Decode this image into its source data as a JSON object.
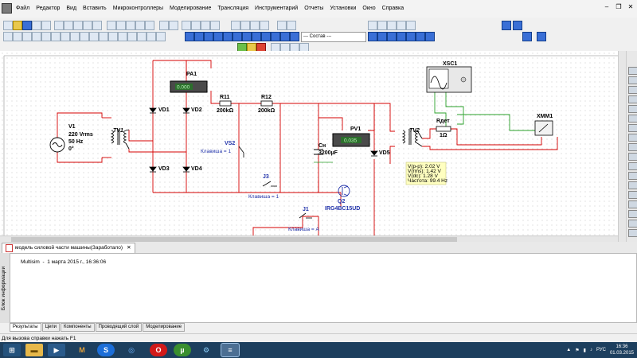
{
  "menu": {
    "items": [
      "Файл",
      "Редактор",
      "Вид",
      "Вставить",
      "Микроконтроллеры",
      "Моделирование",
      "Трансляция",
      "Инструментарий",
      "Отчеты",
      "Установки",
      "Окно",
      "Справка"
    ]
  },
  "toolbar": {
    "select_value": "--- Состав ---"
  },
  "circuit": {
    "V1": {
      "name": "V1",
      "line1": "220 Vrms",
      "line2": "50 Hz",
      "line3": "0°"
    },
    "TV1": "TV1",
    "TV2": "TV2",
    "PA1": {
      "name": "PA1",
      "value": "0.000"
    },
    "PV1": {
      "name": "PV1",
      "value": "0.035"
    },
    "R11": {
      "name": "R11",
      "value": "200kΩ"
    },
    "R12": {
      "name": "R12",
      "value": "200kΩ"
    },
    "VD1": "VD1",
    "VD2": "VD2",
    "VD3": "VD3",
    "VD4": "VD4",
    "VD5": "VD5",
    "VS2": {
      "name": "VS2",
      "key": "Клавиша = 1"
    },
    "Cn": {
      "name": "Сн",
      "value": "3200µF"
    },
    "J3": {
      "name": "J3",
      "key": "Клавиша = 1"
    },
    "J1": {
      "name": "J1",
      "key": "Клавиша = A"
    },
    "Q2": {
      "name": "Q2",
      "model": "IRG4BC15UD"
    },
    "Rdet": {
      "name": "Rдет",
      "value": "1Ω"
    },
    "XSC1": "XSC1",
    "XMM1": "XMM1",
    "measure": {
      "l1": "V(p-p): 2.02 V",
      "l2": "V(rms): 1.42 V",
      "l3": "V(dc): 1.28 V",
      "l4": "Частота: 99.4 Hz"
    }
  },
  "doc_tab": "модель силовой части машины(Заработало)",
  "output": {
    "panel_title": "Блок информации",
    "log": "Multisim  -  1 марта 2015 г., 16:36:06"
  },
  "bottom_tabs": [
    "Результаты",
    "Цепи",
    "Компоненты",
    "Проводящий слой",
    "Моделирование"
  ],
  "status": "Для вызова справки нажать F1",
  "taskbar": {
    "lang": "РУС",
    "time": "16:36",
    "date": "01.03.2015"
  }
}
